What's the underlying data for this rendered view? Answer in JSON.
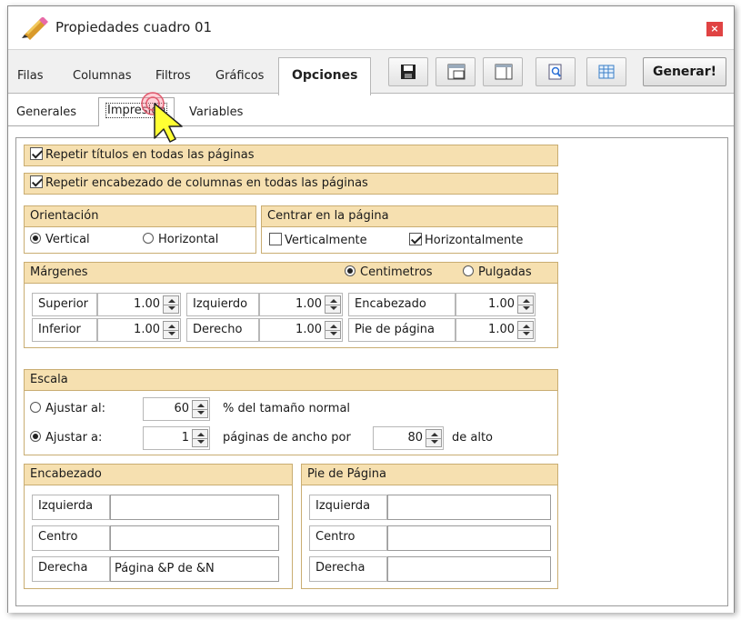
{
  "window": {
    "title": "Propiedades cuadro 01",
    "close_label": "×"
  },
  "main_tabs": [
    "Filas",
    "Columnas",
    "Filtros",
    "Gráficos",
    "Opciones"
  ],
  "toolbar": {
    "icons": [
      "save-icon",
      "layout-icon",
      "columns-icon",
      "preview-icon",
      "table-icon"
    ],
    "generate_label": "Generar!"
  },
  "sub_tabs": [
    "Generales",
    "Impresión",
    "Variables"
  ],
  "impresion": {
    "repeat_titles": {
      "label": "Repetir títulos en todas las páginas",
      "checked": true
    },
    "repeat_headers": {
      "label": "Repetir encabezado de columnas en todas las páginas",
      "checked": true
    },
    "orientation": {
      "title": "Orientación",
      "options": [
        "Vertical",
        "Horizontal"
      ],
      "selected": "Vertical"
    },
    "center": {
      "title": "Centrar en la página",
      "vertical": {
        "label": "Verticalmente",
        "checked": false
      },
      "horizontal": {
        "label": "Horizontalmente",
        "checked": true
      }
    },
    "margins": {
      "title": "Márgenes",
      "units": [
        "Centimetros",
        "Pulgadas"
      ],
      "selected_unit": "Centimetros",
      "fields": [
        {
          "label": "Superior",
          "value": "1.00"
        },
        {
          "label": "Izquierdo",
          "value": "1.00"
        },
        {
          "label": "Encabezado",
          "value": "1.00"
        },
        {
          "label": "Inferior",
          "value": "1.00"
        },
        {
          "label": "Derecho",
          "value": "1.00"
        },
        {
          "label": "Pie de página",
          "value": "1.00"
        }
      ]
    },
    "scale": {
      "title": "Escala",
      "adjust_percent": {
        "label": "Ajustar al:",
        "value": "60",
        "suffix": "% del tamaño normal",
        "selected": false
      },
      "adjust_pages": {
        "label": "Ajustar a:",
        "wide_value": "1",
        "mid_text": "páginas de ancho por",
        "tall_value": "80",
        "suffix": "de alto",
        "selected": true
      }
    },
    "header": {
      "title": "Encabezado",
      "rows": [
        {
          "label": "Izquierda",
          "value": ""
        },
        {
          "label": "Centro",
          "value": ""
        },
        {
          "label": "Derecha",
          "value": "Página &P de &N"
        }
      ]
    },
    "footer": {
      "title": "Pie de Página",
      "rows": [
        {
          "label": "Izquierda",
          "value": ""
        },
        {
          "label": "Centro",
          "value": ""
        },
        {
          "label": "Derecha",
          "value": ""
        }
      ]
    }
  },
  "colors": {
    "group_header_bg": "#f6e0b0",
    "group_border": "#c9ad72",
    "close_button": "#e04343",
    "cursor_fill": "#ffff33"
  }
}
